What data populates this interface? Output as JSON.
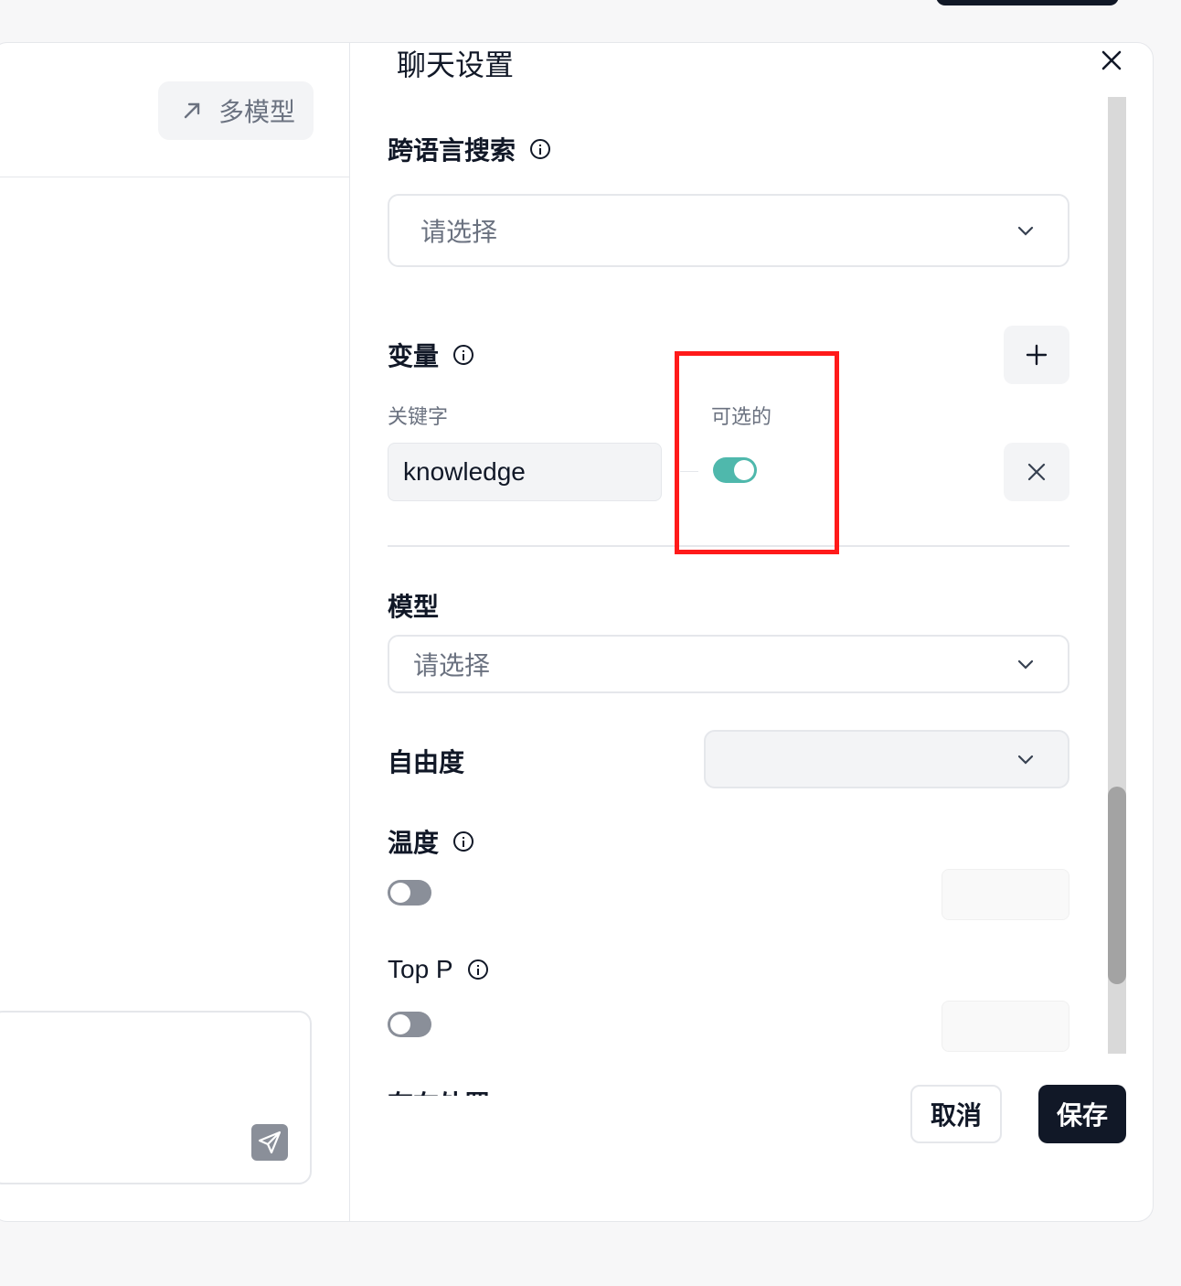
{
  "left_pane": {
    "multi_model_label": "多模型"
  },
  "settings": {
    "title": "聊天设置",
    "cross_lang_search": {
      "label": "跨语言搜索",
      "placeholder": "请选择"
    },
    "variables": {
      "label": "变量",
      "keyword_header": "关键字",
      "optional_header": "可选的",
      "rows": [
        {
          "keyword": "knowledge",
          "optional": true
        }
      ]
    },
    "model": {
      "label": "模型",
      "placeholder": "请选择"
    },
    "freedom": {
      "label": "自由度",
      "value": ""
    },
    "temperature": {
      "label": "温度",
      "enabled": false,
      "value": ""
    },
    "top_p": {
      "label": "Top P",
      "enabled": false,
      "value": ""
    },
    "presence_penalty_partial": {
      "label": "存在处罚"
    }
  },
  "footer": {
    "cancel_label": "取消",
    "save_label": "保存"
  },
  "colors": {
    "accent_toggle_on": "#4fb8ac",
    "toggle_off": "#8a8f99",
    "primary_button": "#111827",
    "highlight": "#ff1a1a"
  }
}
